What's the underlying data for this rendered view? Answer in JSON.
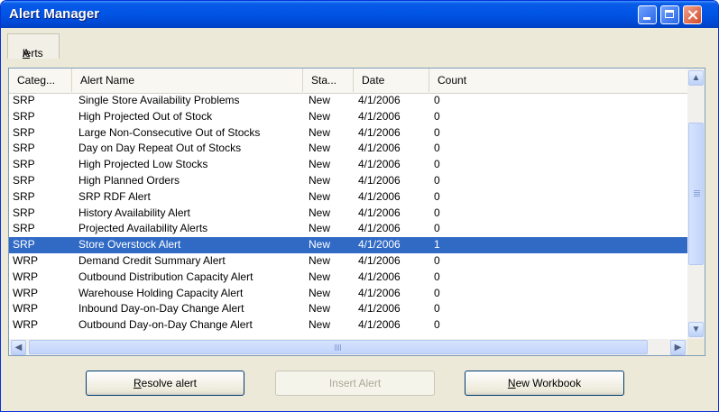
{
  "window": {
    "title": "Alert Manager"
  },
  "menu": {
    "tab_label": "Alerts"
  },
  "columns": [
    "Categ...",
    "Alert Name",
    "Sta...",
    "Date",
    "Count"
  ],
  "rows": [
    {
      "category": "SRP",
      "name": "Single Store Availability Problems",
      "status": "New",
      "date": "4/1/2006",
      "count": "0"
    },
    {
      "category": "SRP",
      "name": "High Projected Out of Stock",
      "status": "New",
      "date": "4/1/2006",
      "count": "0"
    },
    {
      "category": "SRP",
      "name": "Large Non-Consecutive Out of Stocks",
      "status": "New",
      "date": "4/1/2006",
      "count": "0"
    },
    {
      "category": "SRP",
      "name": "Day on Day Repeat Out of Stocks",
      "status": "New",
      "date": "4/1/2006",
      "count": "0"
    },
    {
      "category": "SRP",
      "name": "High Projected Low Stocks",
      "status": "New",
      "date": "4/1/2006",
      "count": "0"
    },
    {
      "category": "SRP",
      "name": "High Planned Orders",
      "status": "New",
      "date": "4/1/2006",
      "count": "0"
    },
    {
      "category": "SRP",
      "name": "SRP RDF Alert",
      "status": "New",
      "date": "4/1/2006",
      "count": "0"
    },
    {
      "category": "SRP",
      "name": "History Availability Alert",
      "status": "New",
      "date": "4/1/2006",
      "count": "0"
    },
    {
      "category": "SRP",
      "name": "Projected Availability Alerts",
      "status": "New",
      "date": "4/1/2006",
      "count": "0"
    },
    {
      "category": "SRP",
      "name": "Store Overstock Alert",
      "status": "New",
      "date": "4/1/2006",
      "count": "1",
      "selected": true
    },
    {
      "category": "WRP",
      "name": "Demand Credit Summary Alert",
      "status": "New",
      "date": "4/1/2006",
      "count": "0"
    },
    {
      "category": "WRP",
      "name": "Outbound Distribution Capacity Alert",
      "status": "New",
      "date": "4/1/2006",
      "count": "0"
    },
    {
      "category": "WRP",
      "name": "Warehouse Holding Capacity Alert",
      "status": "New",
      "date": "4/1/2006",
      "count": "0"
    },
    {
      "category": "WRP",
      "name": "Inbound Day-on-Day Change Alert",
      "status": "New",
      "date": "4/1/2006",
      "count": "0"
    },
    {
      "category": "WRP",
      "name": "Outbound Day-on-Day Change Alert",
      "status": "New",
      "date": "4/1/2006",
      "count": "0"
    }
  ],
  "buttons": {
    "resolve": "Resolve alert",
    "insert": "Insert Alert",
    "new_workbook": "New Workbook"
  },
  "icons": {
    "minimize": "minimize-icon",
    "maximize": "maximize-icon",
    "close": "close-icon",
    "scroll_up": "scroll-up-icon",
    "scroll_down": "scroll-down-icon",
    "scroll_left": "scroll-left-icon",
    "scroll_right": "scroll-right-icon"
  },
  "colors": {
    "title_bar": "#0055e5",
    "selection": "#316ac5",
    "window_face": "#ece9d8"
  }
}
